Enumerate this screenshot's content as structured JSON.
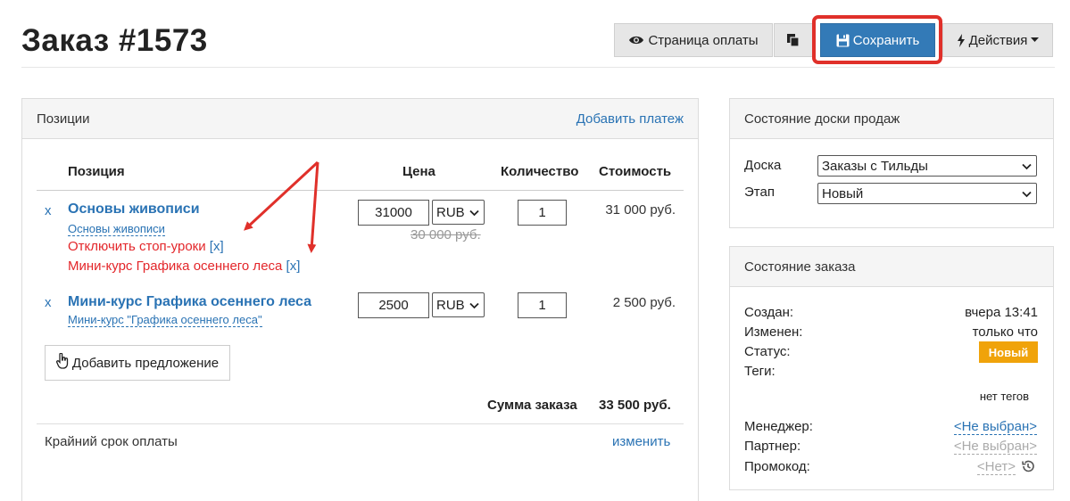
{
  "header": {
    "title": "Заказ #1573",
    "buttons": {
      "payment_page": "Страница оплаты",
      "save": "Сохранить",
      "actions": "Действия"
    }
  },
  "positions_panel": {
    "title": "Позиции",
    "add_payment": "Добавить платеж",
    "columns": [
      "Позиция",
      "Цена",
      "Количество",
      "Стоимость"
    ],
    "items": [
      {
        "remove": "x",
        "title": "Основы живописи",
        "subtitle": "Основы живописи",
        "price": "31000",
        "currency": "RUB",
        "old_price": "30 000 руб.",
        "quantity": "1",
        "cost": "31 000 руб.",
        "notes": [
          {
            "text": "Отключить стоп-уроки",
            "remove": "[x]"
          },
          {
            "text": "Мини-курс Графика осеннего леса",
            "remove": "[x]"
          }
        ]
      },
      {
        "remove": "x",
        "title": "Мини-курс Графика осеннего леса",
        "subtitle": "Мини-курс \"Графика осеннего леса\"",
        "price": "2500",
        "currency": "RUB",
        "quantity": "1",
        "cost": "2 500 руб."
      }
    ],
    "add_offer": "Добавить предложение",
    "total_label": "Сумма заказа",
    "total_value": "33 500 руб.",
    "deadline_label": "Крайний срок оплаты",
    "deadline_change": "изменить"
  },
  "board_panel": {
    "title": "Состояние доски продаж",
    "board_label": "Доска",
    "board_value": "Заказы с Тильды",
    "stage_label": "Этап",
    "stage_value": "Новый"
  },
  "order_panel": {
    "title": "Состояние заказа",
    "created_label": "Создан:",
    "created_value": "вчера 13:41",
    "changed_label": "Изменен:",
    "changed_value": "только что",
    "status_label": "Статус:",
    "status_value": "Новый",
    "tags_label": "Теги:",
    "tags_value": "нет тегов",
    "manager_label": "Менеджер:",
    "manager_value": "<Не выбран>",
    "partner_label": "Партнер:",
    "partner_value": "<Не выбран>",
    "promo_label": "Промокод:",
    "promo_value": "<Нет>"
  },
  "colors": {
    "primary": "#337ab7",
    "link": "#2a73b4",
    "highlight": "#e0302a",
    "red_text": "#e3262a",
    "status_badge": "#f0a30a"
  },
  "icons": [
    "eye-icon",
    "copy-icon",
    "floppy-disk-icon",
    "bolt-icon",
    "caret-down-icon",
    "pointer-hand-icon",
    "history-icon",
    "chevron-down-icon"
  ]
}
